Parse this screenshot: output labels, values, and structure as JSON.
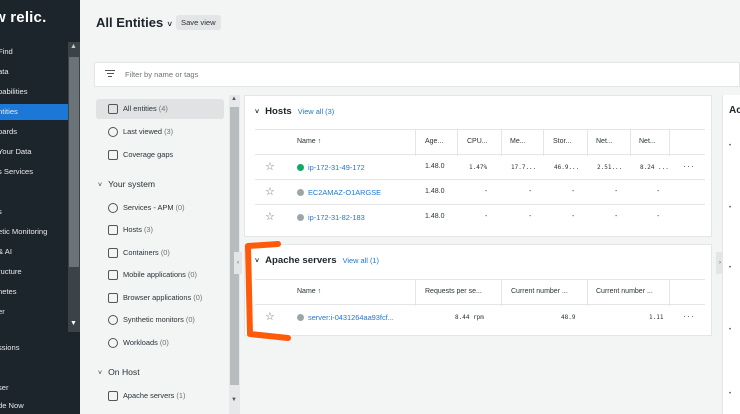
{
  "nav": {
    "logo": "w relic.",
    "items": [
      {
        "label": "Find",
        "active": false
      },
      {
        "label": "ata",
        "active": false
      },
      {
        "label": "pabilities",
        "active": false
      },
      {
        "label": "ntities",
        "active": true
      },
      {
        "label": "oards",
        "active": false
      },
      {
        "label": "Your Data",
        "active": false
      },
      {
        "label": "s Services",
        "active": false
      },
      {
        "label": "s",
        "active": false
      },
      {
        "label": "etic Monitoring",
        "active": false
      },
      {
        "label": "& AI",
        "active": false
      },
      {
        "label": "ructure",
        "active": false
      },
      {
        "label": "netes",
        "active": false
      },
      {
        "label": "er",
        "active": false
      },
      {
        "label": "ssions",
        "active": false
      },
      {
        "label": "ser",
        "active": false
      },
      {
        "label": "de Now",
        "active": false
      }
    ]
  },
  "header": {
    "title": "All Entities",
    "save_view": "Save view"
  },
  "filter": {
    "placeholder": "Filter by name or tags"
  },
  "side": {
    "all_entities": "All entities",
    "all_entities_count": "(4)",
    "last_viewed": "Last viewed",
    "last_viewed_count": "(3)",
    "coverage_gaps": "Coverage gaps",
    "your_system": "Your system",
    "system_items": [
      {
        "label": "Services - APM",
        "count": "(0)"
      },
      {
        "label": "Hosts",
        "count": "(3)"
      },
      {
        "label": "Containers",
        "count": "(0)"
      },
      {
        "label": "Mobile applications",
        "count": "(0)"
      },
      {
        "label": "Browser applications",
        "count": "(0)"
      },
      {
        "label": "Synthetic monitors",
        "count": "(0)"
      },
      {
        "label": "Workloads",
        "count": "(0)"
      }
    ],
    "on_host": "On Host",
    "on_host_items": [
      {
        "label": "Apache servers",
        "count": "(1)"
      }
    ]
  },
  "hosts": {
    "title": "Hosts",
    "view_all": "View all (3)",
    "columns": [
      "Name ↑",
      "Age...",
      "CPU...",
      "Me...",
      "Stor...",
      "Net...",
      "Net..."
    ],
    "rows": [
      {
        "name": "ip-172-31-49-172",
        "status_color": "#11a968",
        "age": "1.48.0",
        "cpu": "1.47%",
        "mem": "17.7...",
        "stor": "46.9...",
        "net1": "2.51...",
        "net2": "8.24 ..."
      },
      {
        "name": "EC2AMAZ-O1ARGSE",
        "status_color": "#9ea5a9",
        "age": "1.48.0",
        "cpu": "-",
        "mem": "-",
        "stor": "-",
        "net1": "-",
        "net2": "-"
      },
      {
        "name": "ip-172-31-82-183",
        "status_color": "#9ea5a9",
        "age": "1.48.0",
        "cpu": "-",
        "mem": "-",
        "stor": "-",
        "net1": "-",
        "net2": "-"
      }
    ]
  },
  "apache": {
    "title": "Apache servers",
    "view_all": "View all (1)",
    "columns": [
      "Name ↑",
      "Requests per se...",
      "Current number ...",
      "Current number ..."
    ],
    "rows": [
      {
        "name": "server:i-0431264aa93fcf...",
        "status_color": "#9ea5a9",
        "req": "8.44 rpm",
        "cur1": "48.9",
        "cur2": "1.11"
      }
    ]
  },
  "right": {
    "title": "Ac"
  },
  "colors": {
    "nav_bg": "#1d252c",
    "accent": "#1c78d6",
    "healthy": "#11a968",
    "annotation": "#ff5a0a"
  },
  "icons": [
    "filter-icon",
    "star-icon",
    "more-icon",
    "caret-down-icon",
    "chevron-left-icon",
    "chevron-right-icon"
  ]
}
